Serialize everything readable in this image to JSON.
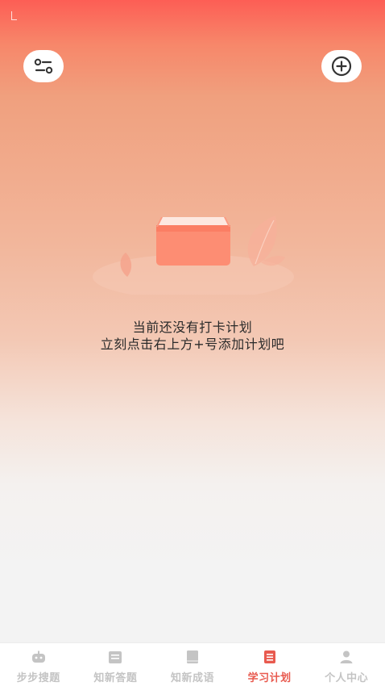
{
  "header": {
    "filter_icon": "filter-settings-icon",
    "add_icon": "plus-circle-icon"
  },
  "empty_state": {
    "line1": "当前还没有打卡计划",
    "line2": "立刻点击右上方+号添加计划吧",
    "illustration_icon": "empty-box-icon"
  },
  "tabbar": {
    "active_index": 3,
    "tabs": [
      {
        "label": "步步搜题",
        "icon": "robot-icon"
      },
      {
        "label": "知新答题",
        "icon": "answer-sheet-icon"
      },
      {
        "label": "知新成语",
        "icon": "book-icon"
      },
      {
        "label": "学习计划",
        "icon": "plan-list-icon"
      },
      {
        "label": "个人中心",
        "icon": "user-icon"
      }
    ]
  },
  "colors": {
    "accent": "#e85a4f",
    "inactive": "#c4c4c4",
    "gradient_top": "#fd5e55"
  }
}
